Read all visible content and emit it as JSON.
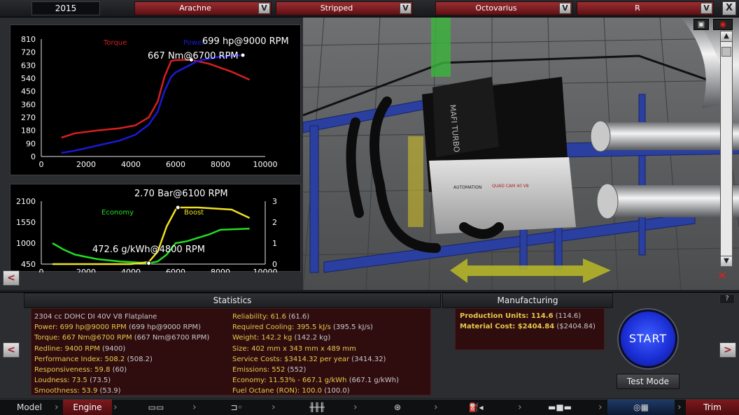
{
  "topbar": {
    "year": "2015",
    "selectors": [
      {
        "label": "Arachne"
      },
      {
        "label": "Stripped"
      },
      {
        "label": "Octovarius"
      },
      {
        "label": "R"
      }
    ],
    "dropdown_glyph": "V",
    "close_glyph": "X"
  },
  "chart_data": [
    {
      "type": "line",
      "title": "",
      "y_ticks": [
        0,
        90,
        180,
        270,
        360,
        450,
        540,
        630,
        720,
        810
      ],
      "x_ticks": [
        0,
        2000,
        4000,
        6000,
        8000,
        10000
      ],
      "ylim": [
        0,
        810
      ],
      "xlim": [
        0,
        10000
      ],
      "series": [
        {
          "name": "Torque",
          "color": "#d62020",
          "x": [
            900,
            1500,
            2500,
            3500,
            4200,
            4800,
            5200,
            5500,
            5800,
            6000,
            6500,
            6700,
            7500,
            8500,
            9300
          ],
          "values": [
            130,
            160,
            180,
            195,
            215,
            270,
            380,
            550,
            660,
            665,
            668,
            667,
            640,
            585,
            530
          ]
        },
        {
          "name": "Power",
          "color": "#1a1ad8",
          "x": [
            900,
            1500,
            2500,
            3500,
            4200,
            4800,
            5200,
            5500,
            5800,
            6000,
            6500,
            7000,
            8000,
            9000
          ],
          "values": [
            25,
            40,
            75,
            110,
            150,
            220,
            310,
            450,
            550,
            580,
            620,
            660,
            690,
            699
          ]
        }
      ],
      "annotations": [
        "699 hp@9000 RPM",
        "667 Nm@6700 RPM"
      ]
    },
    {
      "type": "line",
      "title": "",
      "y_ticks": [
        450,
        1000,
        1550,
        2100
      ],
      "y2_ticks": [
        0,
        1,
        2,
        3
      ],
      "x_ticks": [
        0,
        2000,
        4000,
        6000,
        8000,
        10000
      ],
      "ylim": [
        450,
        2100
      ],
      "y2lim": [
        0,
        3
      ],
      "xlim": [
        0,
        10000
      ],
      "series": [
        {
          "name": "Economy",
          "color": "#22dd22",
          "axis": "left",
          "x": [
            500,
            1000,
            1500,
            2500,
            3500,
            4300,
            4800,
            5200,
            5600,
            6000,
            6500,
            7500,
            8000,
            9300
          ],
          "values": [
            1000,
            830,
            700,
            580,
            520,
            490,
            472.6,
            520,
            700,
            1000,
            1050,
            1230,
            1350,
            1380
          ]
        },
        {
          "name": "Boost",
          "color": "#f0e020",
          "axis": "right",
          "x": [
            500,
            2500,
            4000,
            4800,
            5200,
            5600,
            6000,
            6100,
            7000,
            8500,
            9300
          ],
          "values": [
            0,
            0,
            0,
            0.1,
            0.6,
            1.8,
            2.6,
            2.7,
            2.7,
            2.6,
            2.2
          ]
        }
      ],
      "annotations": [
        "2.70 Bar@6100 RPM",
        "472.6 g/kWh@4800 RPM"
      ]
    }
  ],
  "left": {
    "back_glyph": "<"
  },
  "statistics": {
    "header": "Statistics",
    "col1": [
      {
        "text": "2304 cc DOHC DI 40V V8 Flatplane",
        "key": ""
      },
      {
        "key": "Power: 699 hp@9000 RPM",
        "text": " (699 hp@9000 RPM)"
      },
      {
        "key": "Torque: 667 Nm@6700 RPM",
        "text": " (667 Nm@6700 RPM)"
      },
      {
        "key": "Redline: 9400 RPM",
        "text": " (9400)"
      },
      {
        "key": "Performance Index: 508.2",
        "text": " (508.2)"
      },
      {
        "key": "Responsiveness: 59.8",
        "text": " (60)"
      },
      {
        "key": "Loudness: 73.5",
        "text": " (73.5)"
      },
      {
        "key": "Smoothness: 53.9",
        "text": " (53.9)"
      }
    ],
    "col2": [
      {
        "key": "Reliability: 61.6",
        "text": " (61.6)"
      },
      {
        "key": "Required Cooling: 395.5 kJ/s",
        "text": " (395.5 kJ/s)"
      },
      {
        "key": "Weight: 142.2 kg",
        "text": " (142.2 kg)"
      },
      {
        "key": "Size: 402 mm x 343 mm x 489 mm",
        "text": ""
      },
      {
        "key": "Service Costs: $3414.32 per year",
        "text": " (3414.32)"
      },
      {
        "key": "Emissions: 552",
        "text": " (552)"
      },
      {
        "key": "Economy: 11.53% - 667.1 g/kWh",
        "text": " (667.1 g/kWh)"
      },
      {
        "key": "Fuel Octane (RON): 100.0",
        "text": " (100.0)"
      }
    ]
  },
  "manufacturing": {
    "header": "Manufacturing",
    "rows": [
      {
        "key": "Production Units: 114.6",
        "text": " (114.6)"
      },
      {
        "key": "Material Cost: $2404.84",
        "text": " ($2404.84)"
      }
    ]
  },
  "controls": {
    "start": "START",
    "test_mode": "Test Mode",
    "prev_glyph": "<",
    "next_glyph": ">",
    "help_glyph": "?"
  },
  "viewport": {
    "engine_brand": "MAFI TURBO",
    "engine_label": "AUTOMATION",
    "engine_label2": "QUAD CAM 40 V8"
  },
  "tabs": [
    {
      "label": "Model",
      "icon": ""
    },
    {
      "label": "Engine",
      "icon": ""
    },
    {
      "label": "",
      "icon": "chassis-icon"
    },
    {
      "label": "",
      "icon": "suspension-icon"
    },
    {
      "label": "",
      "icon": "drivetrain-icon"
    },
    {
      "label": "",
      "icon": "wheel-icon"
    },
    {
      "label": "",
      "icon": "fuel-icon"
    },
    {
      "label": "",
      "icon": "exhaust-icon"
    },
    {
      "label": "",
      "icon": "gauges-icon"
    },
    {
      "label": "Trim",
      "icon": ""
    }
  ]
}
